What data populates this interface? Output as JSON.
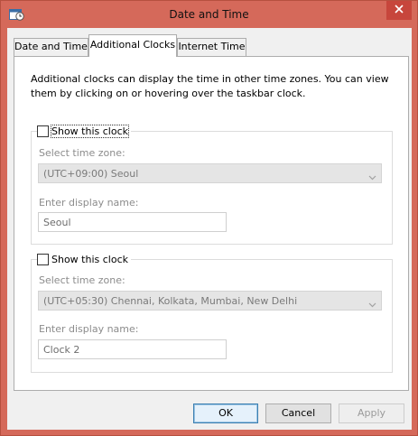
{
  "window": {
    "title": "Date and Time",
    "close_glyph": "✕"
  },
  "tabs": [
    {
      "label": "Date and Time"
    },
    {
      "label": "Additional Clocks"
    },
    {
      "label": "Internet Time"
    }
  ],
  "active_tab": "Additional Clocks",
  "intro": "Additional clocks can display the time in other time zones. You can view them by clicking on or hovering over the taskbar clock.",
  "clocks": [
    {
      "show_label": "Show this clock",
      "checked": false,
      "time_zone_label": "Select time zone:",
      "time_zone": "(UTC+09:00) Seoul",
      "display_name_label": "Enter display name:",
      "display_name": "Seoul"
    },
    {
      "show_label": "Show this clock",
      "checked": false,
      "time_zone_label": "Select time zone:",
      "time_zone": "(UTC+05:30) Chennai, Kolkata, Mumbai, New Delhi",
      "display_name_label": "Enter display name:",
      "display_name": "Clock 2"
    }
  ],
  "buttons": {
    "ok": "OK",
    "cancel": "Cancel",
    "apply": "Apply"
  },
  "colors": {
    "frame": "#d5695a",
    "close": "#c7463c",
    "default_button_border": "#3c7fb1"
  },
  "icons": {
    "app": "calendar-clock-icon",
    "close": "close-icon",
    "dropdown": "chevron-down-icon"
  }
}
